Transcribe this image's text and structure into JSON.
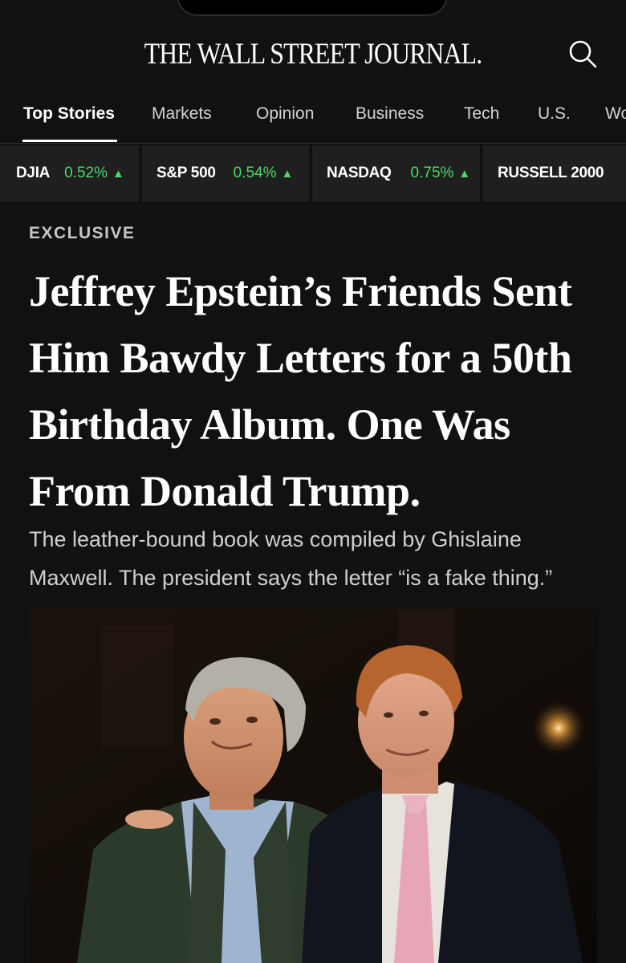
{
  "masthead": {
    "logo_text": "THE WALL STREET JOURNAL."
  },
  "nav": {
    "tabs": [
      {
        "label": "Top Stories",
        "active": true
      },
      {
        "label": "Markets"
      },
      {
        "label": "Opinion"
      },
      {
        "label": "Business"
      },
      {
        "label": "Tech"
      },
      {
        "label": "U.S."
      },
      {
        "label": "Wo"
      }
    ]
  },
  "ticker": [
    {
      "name": "DJIA",
      "change": "0.52%",
      "direction": "up"
    },
    {
      "name": "S&P 500",
      "change": "0.54%",
      "direction": "up"
    },
    {
      "name": "NASDAQ",
      "change": "0.75%",
      "direction": "up"
    },
    {
      "name": "RUSSELL 2000",
      "change": "",
      "direction": ""
    }
  ],
  "article": {
    "flag": "EXCLUSIVE",
    "headline": "Jeffrey Epstein’s Friends Sent Him Bawdy Letters for a 50th Birthday Album. One Was From Donald Trump.",
    "dek": "The leather-bound book was compiled by Ghislaine Maxwell. The president says the letter “is a fake thing.”"
  },
  "colors": {
    "background": "#111111",
    "ticker_up": "#4cd964",
    "tile": "#1f1f1f"
  },
  "icons": {
    "search": "search-icon",
    "up_arrow": "triangle-up-icon"
  }
}
